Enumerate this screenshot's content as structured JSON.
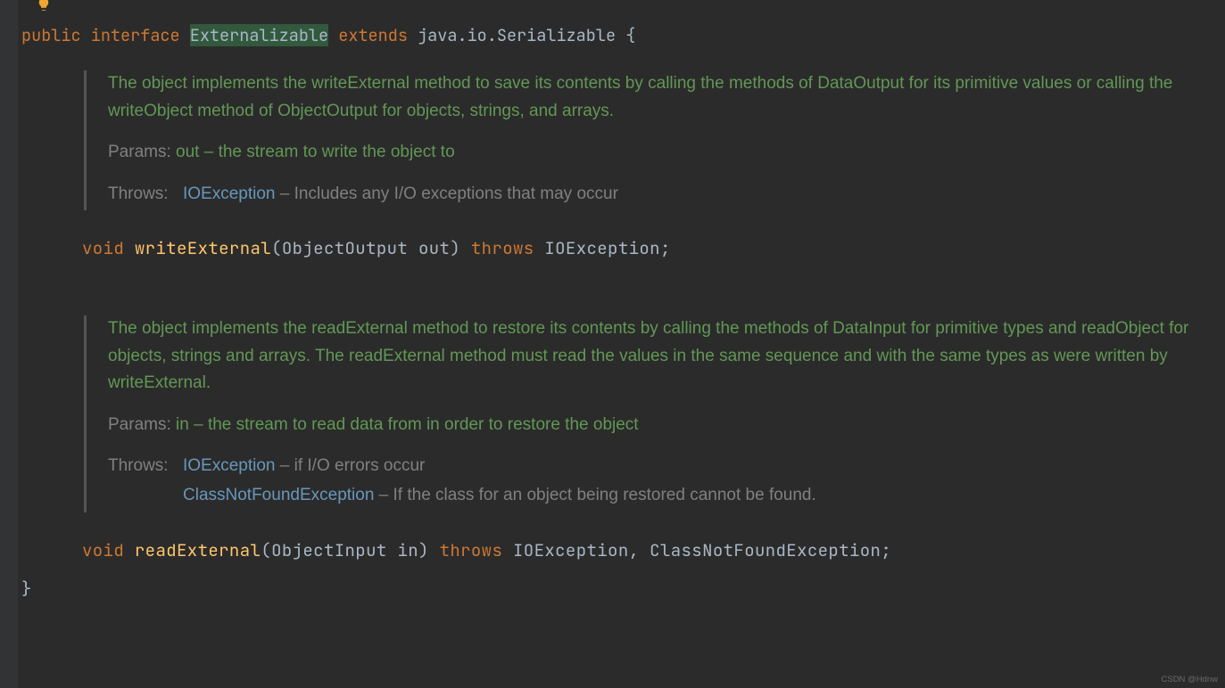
{
  "gutter": {
    "bulb_icon": "lightbulb-icon"
  },
  "declaration": {
    "modifier": "public",
    "keyword": "interface",
    "name": "Externalizable",
    "extends_kw": "extends",
    "super_type": "java.io.Serializable",
    "brace_open": "{",
    "brace_close": "}"
  },
  "methods": [
    {
      "doc": {
        "summary": "The object implements the writeExternal method to save its contents by calling the methods of DataOutput for its primitive values or calling the writeObject method of ObjectOutput for objects, strings, and arrays.",
        "params": {
          "label": "Params:",
          "text": "out – the stream to write the object to"
        },
        "throws": {
          "label": "Throws:",
          "items": [
            {
              "exc": "IOException",
              "desc": " – Includes any I/O exceptions that may occur"
            }
          ]
        }
      },
      "signature": {
        "return": "void",
        "name": "writeExternal",
        "lparen": "(",
        "param_type": "ObjectOutput",
        "param_name": "out",
        "rparen": ")",
        "throws_kw": "throws",
        "exceptions": "IOException",
        "semi": ";"
      }
    },
    {
      "doc": {
        "summary": "The object implements the readExternal method to restore its contents by calling the methods of DataInput for primitive types and readObject for objects, strings and arrays. The readExternal method must read the values in the same sequence and with the same types as were written by writeExternal.",
        "params": {
          "label": "Params:",
          "text": "in – the stream to read data from in order to restore the object"
        },
        "throws": {
          "label": "Throws:",
          "items": [
            {
              "exc": "IOException",
              "desc": " – if I/O errors occur"
            },
            {
              "exc": "ClassNotFoundException",
              "desc": " – If the class for an object being restored cannot be found."
            }
          ]
        }
      },
      "signature": {
        "return": "void",
        "name": "readExternal",
        "lparen": "(",
        "param_type": "ObjectInput",
        "param_name": "in",
        "rparen": ")",
        "throws_kw": "throws",
        "exceptions": "IOException, ClassNotFoundException",
        "semi": ";"
      }
    }
  ],
  "watermark": "CSDN @Hdnw"
}
